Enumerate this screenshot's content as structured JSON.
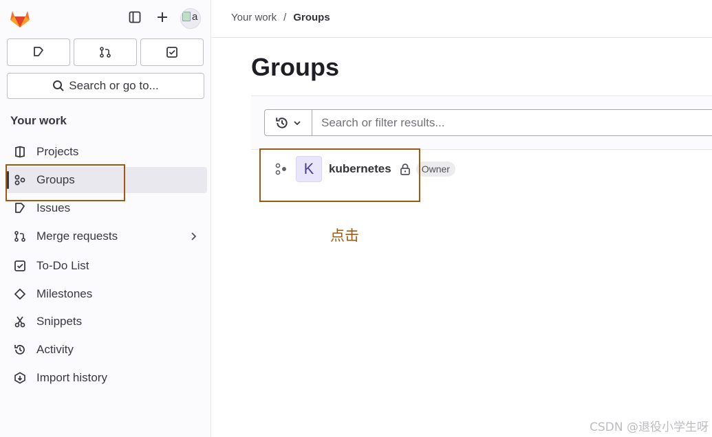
{
  "sidebar": {
    "search_label": "Search or go to...",
    "section_title": "Your work",
    "items": [
      {
        "label": "Projects",
        "icon": "project-icon"
      },
      {
        "label": "Groups",
        "icon": "group-icon",
        "active": true
      },
      {
        "label": "Issues",
        "icon": "issues-icon"
      },
      {
        "label": "Merge requests",
        "icon": "merge-request-icon",
        "has_chevron": true
      },
      {
        "label": "To-Do List",
        "icon": "todo-icon"
      },
      {
        "label": "Milestones",
        "icon": "milestone-icon"
      },
      {
        "label": "Snippets",
        "icon": "snippet-icon"
      },
      {
        "label": "Activity",
        "icon": "history-icon"
      },
      {
        "label": "Import history",
        "icon": "import-icon"
      }
    ],
    "avatar_alt": "a"
  },
  "breadcrumb": {
    "parent": "Your work",
    "separator": "/",
    "current": "Groups"
  },
  "page": {
    "title": "Groups",
    "filter_placeholder": "Search or filter results..."
  },
  "groups": [
    {
      "initial": "K",
      "name": "kubernetes",
      "visibility": "private",
      "role": "Owner"
    }
  ],
  "annotation": {
    "text": "点击",
    "color": "#a0580f"
  },
  "watermark": "CSDN @退役小学生呀",
  "colors": {
    "accent_highlight": "#a0580f",
    "gitlab_orange": "#e24329"
  }
}
